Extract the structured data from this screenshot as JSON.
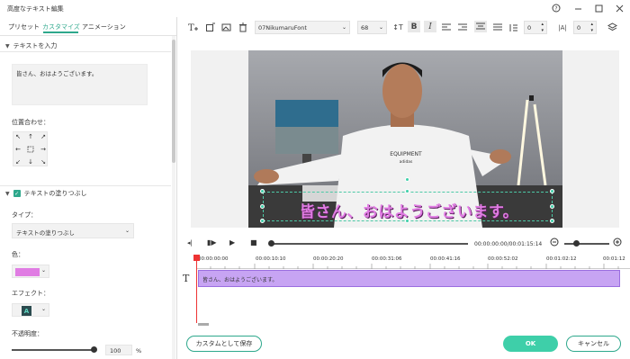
{
  "window": {
    "title": "高度なテキスト編集"
  },
  "tabs": [
    {
      "label": "プリセット"
    },
    {
      "label": "カスタマイズ"
    },
    {
      "label": "アニメーション"
    }
  ],
  "left": {
    "text_input_label": "テキストを入力",
    "text_value": "皆さん、おはようございます。",
    "align_label": "位置合わせ：",
    "fill_label": "テキストの塗りつぶし",
    "type_label": "タイプ：",
    "type_value": "テキストの塗りつぶし",
    "color_label": "色：",
    "color_value": "#e07ce3",
    "effect_label": "エフェクト：",
    "effect_letter": "A",
    "opacity_label": "不透明度：",
    "opacity_value": "100",
    "opacity_unit": "%"
  },
  "toolbar": {
    "font": "07NikumaruFont",
    "size": "68",
    "spacing_value": "0",
    "line_value": "0"
  },
  "preview": {
    "subtitle": "皆さん、おはようございます。",
    "shirt_text": "EQUIPMENT",
    "shirt_brand": "adidas"
  },
  "playback": {
    "timecode": "00:00:00:00/00:01:15:14"
  },
  "timeline": {
    "ticks": [
      "00:00:00:00",
      "00:00:10:10",
      "00:00:20:20",
      "00:00:31:06",
      "00:00:41:16",
      "00:00:52:02",
      "00:01:02:12",
      "00:01:12"
    ],
    "clip_text": "皆さん、おはようございます。"
  },
  "buttons": {
    "save_custom": "カスタムとして保存",
    "ok": "OK",
    "cancel": "キャンセル"
  }
}
